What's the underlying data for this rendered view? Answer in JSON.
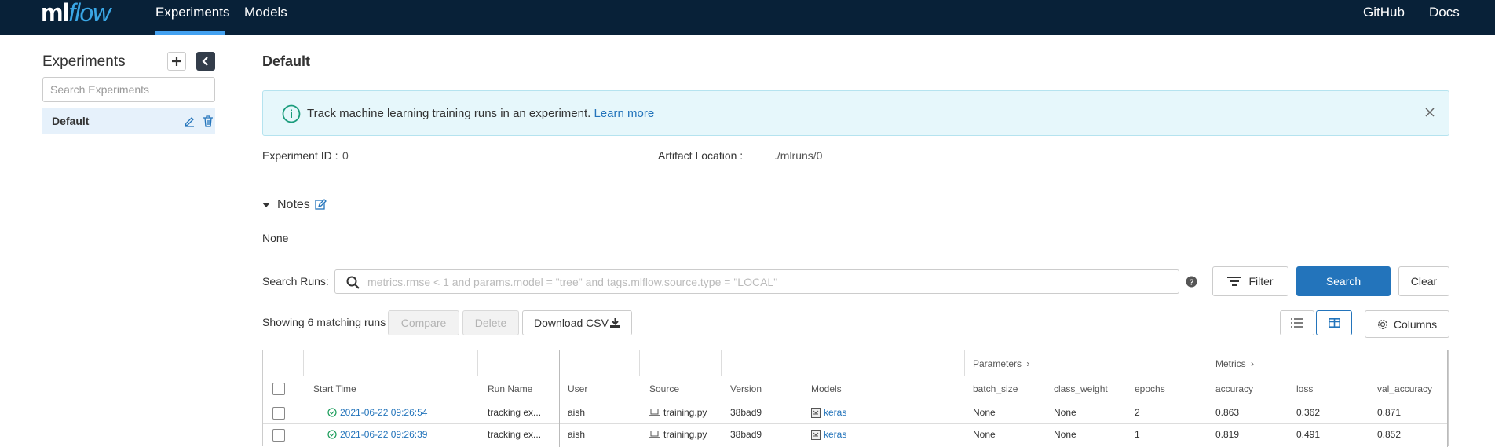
{
  "nav": {
    "logo_ml": "ml",
    "logo_flow": "flow",
    "experiments": "Experiments",
    "models": "Models",
    "github": "GitHub",
    "docs": "Docs"
  },
  "sidebar": {
    "title": "Experiments",
    "search_placeholder": "Search Experiments",
    "items": [
      {
        "label": "Default"
      }
    ]
  },
  "main": {
    "title": "Default",
    "banner": {
      "text": "Track machine learning training runs in an experiment.",
      "link": "Learn more"
    },
    "experiment_id_label": "Experiment ID :",
    "experiment_id": "0",
    "artifact_label": "Artifact Location :",
    "artifact_location": "./mlruns/0",
    "notes_title": "Notes",
    "notes_value": "None",
    "search_runs_label": "Search Runs:",
    "search_placeholder": "metrics.rmse < 1 and params.model = \"tree\" and tags.mlflow.source.type = \"LOCAL\"",
    "filter_label": "Filter",
    "search_label": "Search",
    "clear_label": "Clear",
    "showing": "Showing 6 matching runs",
    "compare_label": "Compare",
    "delete_label": "Delete",
    "download_label": "Download CSV",
    "columns_label": "Columns"
  },
  "table": {
    "group_parameters": "Parameters",
    "group_metrics": "Metrics",
    "headers": [
      "Start Time",
      "Run Name",
      "User",
      "Source",
      "Version",
      "Models",
      "batch_size",
      "class_weight",
      "epochs",
      "accuracy",
      "loss",
      "val_accuracy"
    ],
    "rows": [
      {
        "start_time": "2021-06-22 09:26:54",
        "run_name": "tracking ex...",
        "user": "aish",
        "source": "training.py",
        "version": "38bad9",
        "model": "keras",
        "batch_size": "None",
        "class_weight": "None",
        "epochs": "2",
        "accuracy": "0.863",
        "loss": "0.362",
        "val_accuracy": "0.871"
      },
      {
        "start_time": "2021-06-22 09:26:39",
        "run_name": "tracking ex...",
        "user": "aish",
        "source": "training.py",
        "version": "38bad9",
        "model": "keras",
        "batch_size": "None",
        "class_weight": "None",
        "epochs": "1",
        "accuracy": "0.819",
        "loss": "0.491",
        "val_accuracy": "0.852"
      }
    ]
  }
}
